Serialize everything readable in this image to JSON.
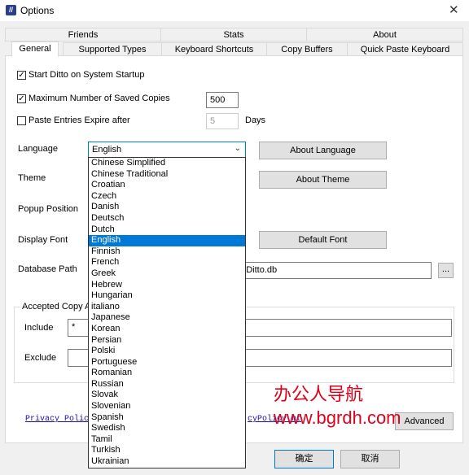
{
  "window": {
    "title": "Options",
    "app_icon_text": "//",
    "close_glyph": "✕"
  },
  "tabs_back": [
    "Friends",
    "Stats",
    "About"
  ],
  "tabs_front": [
    "General",
    "Supported Types",
    "Keyboard Shortcuts",
    "Copy Buffers",
    "Quick Paste Keyboard"
  ],
  "general": {
    "start_on_startup": {
      "label": "Start Ditto on System Startup",
      "checked": true
    },
    "max_copies": {
      "label": "Maximum Number of Saved Copies",
      "checked": true,
      "value": "500"
    },
    "expire": {
      "label": "Paste Entries Expire after",
      "checked": false,
      "value": "5",
      "unit": "Days"
    },
    "language_label": "Language",
    "language_value": "English",
    "about_language_btn": "About Language",
    "theme_label": "Theme",
    "about_theme_btn": "About Theme",
    "popup_label": "Popup Position",
    "font_label": "Display Font",
    "default_font_btn": "Default Font",
    "db_label": "Database Path",
    "db_value": "to\\Ditto.db",
    "browse_btn": "...",
    "accepted_label": "Accepted Copy A",
    "include_label": "Include",
    "include_value": "*",
    "exclude_label": "Exclude",
    "exclude_value": "",
    "privacy_link_left": "Privacy Policy:",
    "privacy_link_right": "cyPolicy.ht",
    "advanced_btn": "Advanced"
  },
  "languages": [
    "Chinese Simplified",
    "Chinese Traditional",
    "Croatian",
    "Czech",
    "Danish",
    "Deutsch",
    "Dutch",
    "English",
    "Finnish",
    "French",
    "Greek",
    "Hebrew",
    "Hungarian",
    "italiano",
    "Japanese",
    "Korean",
    "Persian",
    "Polski",
    "Portuguese",
    "Romanian",
    "Russian",
    "Slovak",
    "Slovenian",
    "Spanish",
    "Swedish",
    "Tamil",
    "Turkish",
    "Ukrainian"
  ],
  "selected_language_index": 7,
  "footer": {
    "ok_btn": "确定",
    "cancel_btn": "取消"
  },
  "watermark": {
    "line1": "办公人导航",
    "line2": "www.bgrdh.com"
  },
  "colors": {
    "accent": "#0078d7",
    "watermark": "#e0001a"
  }
}
